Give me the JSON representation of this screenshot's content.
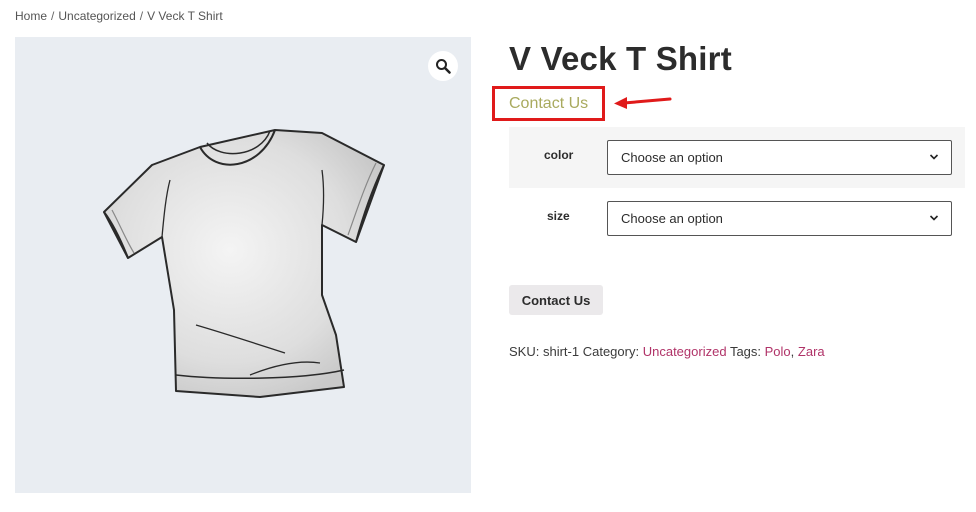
{
  "breadcrumb": {
    "home": "Home",
    "separator": "/",
    "category": "Uncategorized",
    "current": "V Veck T Shirt"
  },
  "gallery": {
    "zoom_icon": "magnifier-icon",
    "image": "t-shirt illustration"
  },
  "product": {
    "title": "V Veck T Shirt",
    "contact_link": "Contact Us"
  },
  "variations": [
    {
      "label": "color",
      "selected": "Choose an option"
    },
    {
      "label": "size",
      "selected": "Choose an option"
    }
  ],
  "actions": {
    "contact_button": "Contact Us"
  },
  "meta": {
    "sku_label": "SKU:",
    "sku": "shirt-1",
    "category_label": "Category:",
    "category": "Uncategorized",
    "tags_label": "Tags:",
    "tag1": "Polo",
    "tag_sep": ",",
    "tag2": "Zara"
  },
  "colors": {
    "annotation": "#e01a1a",
    "contact_link": "#a9aa5e",
    "link": "#b03368",
    "gallery_bg": "#e9edf2"
  }
}
